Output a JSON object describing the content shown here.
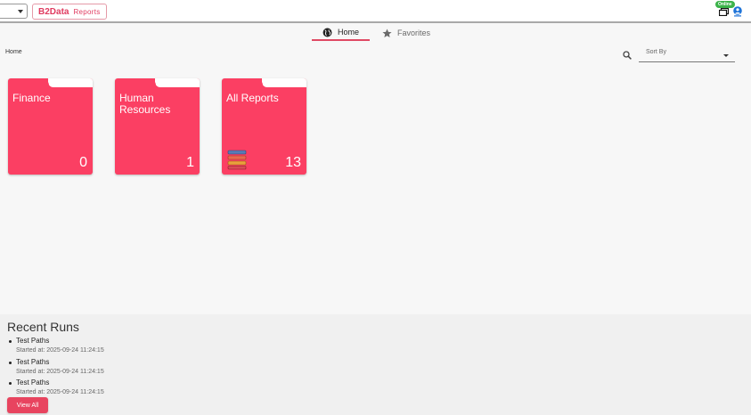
{
  "header": {
    "brand_name": "B2Data",
    "brand_product": "Reports",
    "status_badge": "Online"
  },
  "tabs": [
    {
      "label": "Home",
      "icon": "globe-icon",
      "active": true
    },
    {
      "label": "Favorites",
      "icon": "star-icon",
      "active": false
    }
  ],
  "breadcrumb": "Home",
  "sort": {
    "placeholder": "Sort By",
    "value": ""
  },
  "folders": [
    {
      "title": "Finance",
      "count": "0"
    },
    {
      "title": "Human Resources",
      "count": "1"
    },
    {
      "title": "All Reports",
      "count": "13"
    }
  ],
  "recent_runs": {
    "title": "Recent Runs",
    "items": [
      {
        "name": "Test Paths",
        "started": "Started at: 2025-09-24 11:24:15"
      },
      {
        "name": "Test Paths",
        "started": "Started at: 2025-09-24 11:24:15"
      },
      {
        "name": "Test Paths",
        "started": "Started at: 2025-09-24 11:24:15"
      }
    ],
    "view_all_label": "View All"
  },
  "colors": {
    "accent": "#fb3f63",
    "button": "#e8445f",
    "online": "#3cb34a"
  }
}
